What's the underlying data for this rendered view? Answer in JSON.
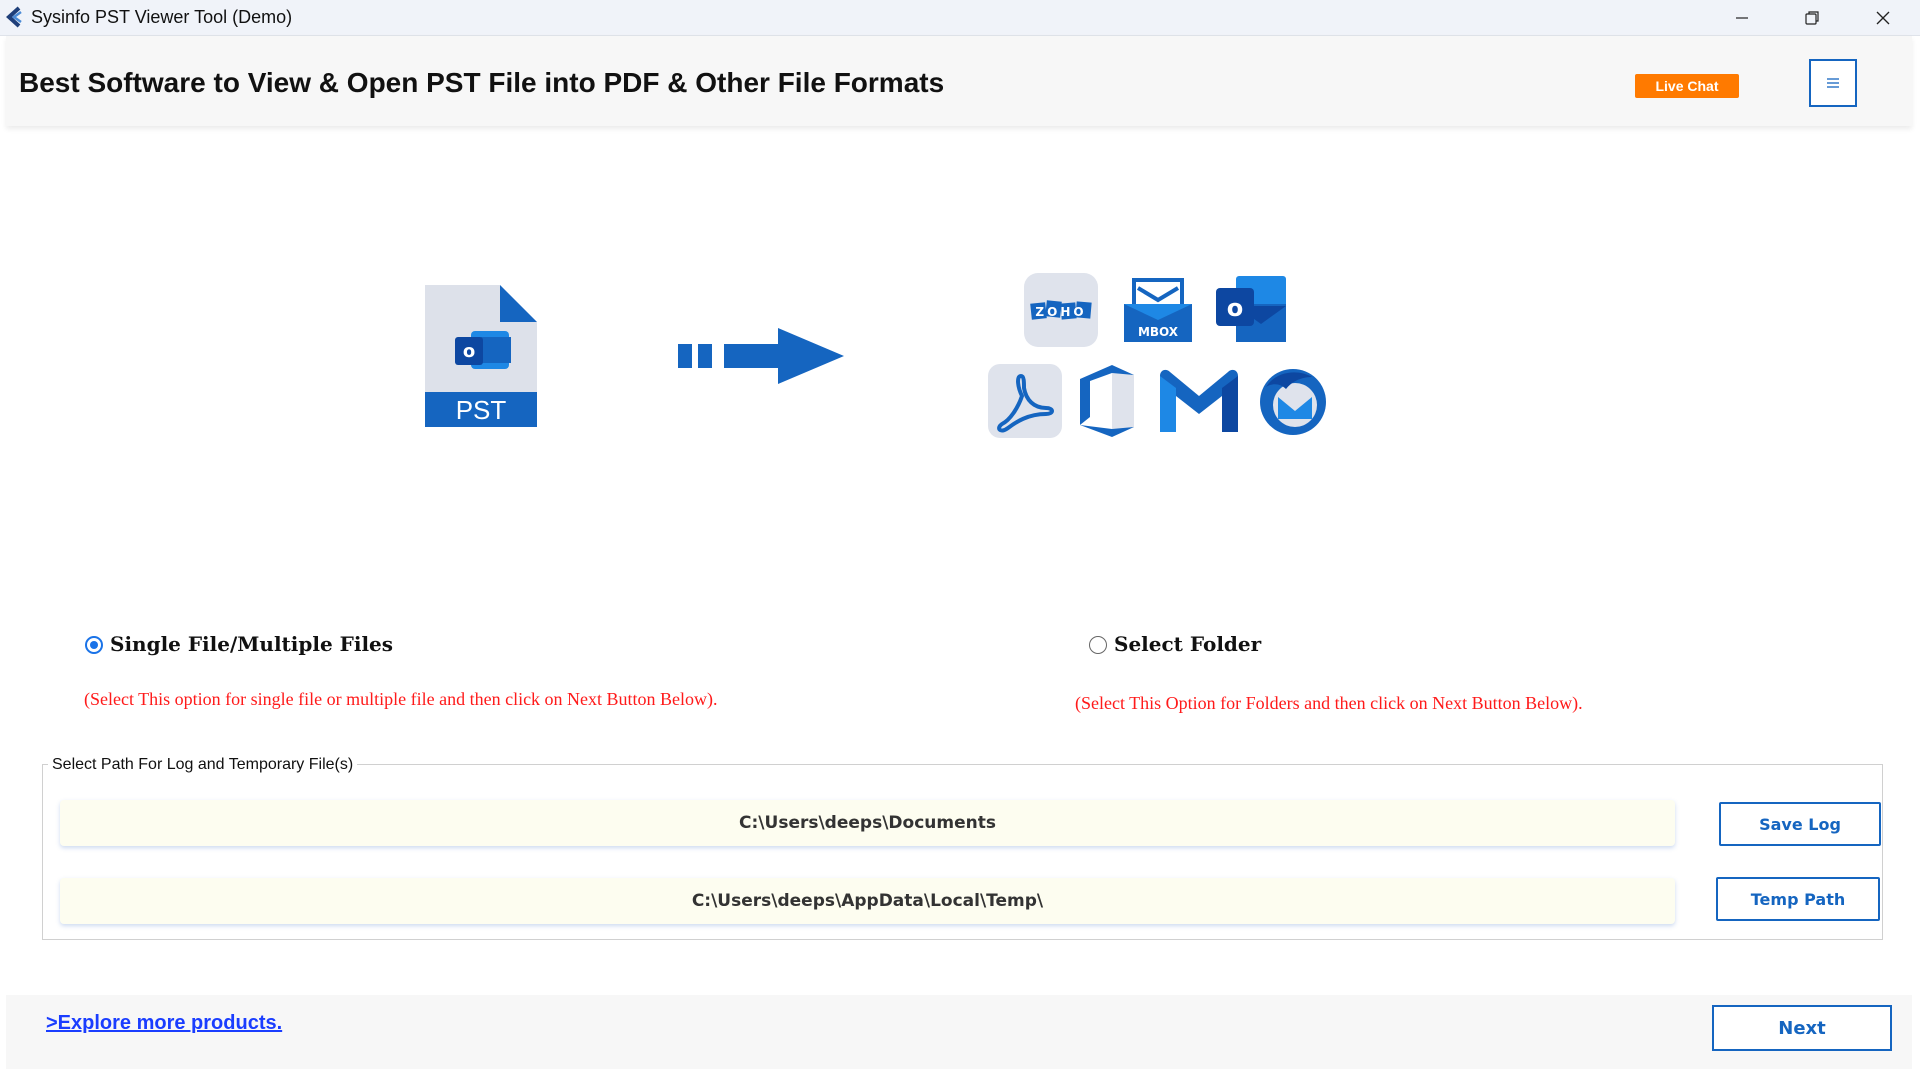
{
  "window": {
    "title": "Sysinfo PST Viewer Tool (Demo)",
    "controls": [
      "minimize-icon",
      "restore-icon",
      "close-icon"
    ]
  },
  "header": {
    "headline": "Best Software to View & Open PST File into PDF & Other File Formats",
    "live_chat_label": "Live Chat",
    "menu_icon": "hamburger-icon"
  },
  "illustration": {
    "source_label": "PST",
    "target_icons": [
      "zoho-icon",
      "mbox-icon",
      "outlook-icon",
      "pdf-icon",
      "office365-icon",
      "gmail-icon",
      "thunderbird-icon"
    ],
    "zoho_text": "ZOHO",
    "mbox_text": "MBOX"
  },
  "options": {
    "single": {
      "label": "Single File/Multiple Files",
      "hint": "(Select This option for single file or multiple file and then click on Next Button Below).",
      "selected": true
    },
    "folder": {
      "label": "Select Folder",
      "hint": "(Select This Option for Folders and then click on Next Button Below).",
      "selected": false
    }
  },
  "paths": {
    "group_label": "Select Path For Log and Temporary File(s)",
    "log_path": "C:\\Users\\deeps\\Documents",
    "temp_path": "C:\\Users\\deeps\\AppData\\Local\\Temp\\",
    "save_log_label": "Save Log",
    "temp_path_label": "Temp Path"
  },
  "footer": {
    "explore_label": ">Explore more products.",
    "next_label": "Next"
  },
  "colors": {
    "accent": "#1565c0",
    "live_chat": "#ff7a00",
    "hint": "#ff1a1a",
    "link": "#1a3dff"
  }
}
